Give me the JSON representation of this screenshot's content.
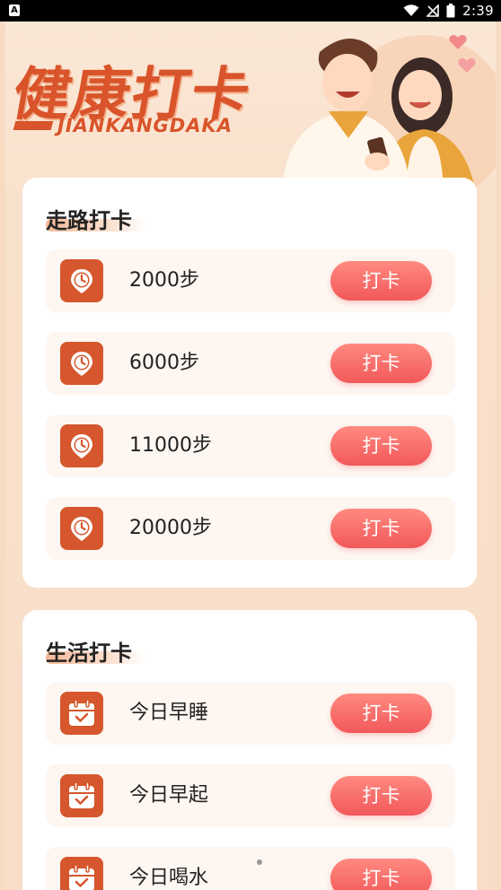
{
  "status_bar": {
    "left_badge": "A",
    "time": "2:39"
  },
  "header": {
    "title_cn": "健康打卡",
    "title_en": "JIANKANGDAKA"
  },
  "walk_section": {
    "title": "走路打卡",
    "items": [
      {
        "label": "2000步",
        "button": "打卡",
        "icon": "clock-pin-icon"
      },
      {
        "label": "6000步",
        "button": "打卡",
        "icon": "clock-pin-icon"
      },
      {
        "label": "11000步",
        "button": "打卡",
        "icon": "clock-pin-icon"
      },
      {
        "label": "20000步",
        "button": "打卡",
        "icon": "clock-pin-icon"
      }
    ]
  },
  "life_section": {
    "title": "生活打卡",
    "items": [
      {
        "label": "今日早睡",
        "button": "打卡",
        "icon": "calendar-check-icon"
      },
      {
        "label": "今日早起",
        "button": "打卡",
        "icon": "calendar-check-icon"
      },
      {
        "label": "今日喝水",
        "button": "打卡",
        "icon": "calendar-check-icon"
      }
    ]
  },
  "colors": {
    "accent": "#d6572d",
    "button": "#f2585a",
    "background": "#f8ddc8"
  }
}
